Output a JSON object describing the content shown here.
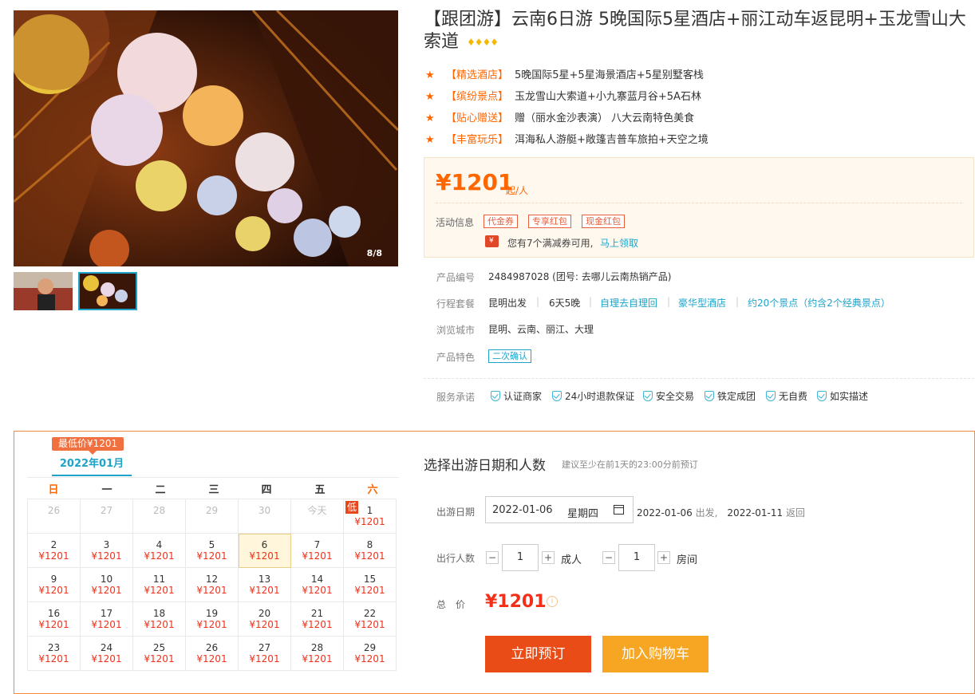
{
  "gallery": {
    "counter": "8/8"
  },
  "product": {
    "title": "【跟团游】云南6日游 5晚国际5星酒店+丽江动车返昆明+玉龙雪山大索道",
    "rating_icon": "diamond-icon"
  },
  "highlights": [
    {
      "tag": "【精选酒店】",
      "text": "5晚国际5星+5星海景酒店+5星别墅客栈"
    },
    {
      "tag": "【缤纷景点】",
      "text": "玉龙雪山大索道+小九寨蓝月谷+5A石林"
    },
    {
      "tag": "【贴心赠送】",
      "text": "赠（丽水金沙表演） 八大云南特色美食"
    },
    {
      "tag": "【丰富玩乐】",
      "text": "洱海私人游艇+敞篷吉普车旅拍+天空之境"
    }
  ],
  "price": {
    "amount": "¥1201",
    "suffix": "起/人",
    "promo_label": "活动信息",
    "promo_tags": [
      "代金券",
      "专享红包",
      "现金红包"
    ],
    "coupon_text": "您有7个满减券可用,",
    "coupon_link": "马上领取"
  },
  "info": {
    "product_no_label": "产品编号",
    "product_no": "2484987028 (团号: 去哪儿云南热销产品)",
    "itinerary_label": "行程套餐",
    "itinerary": [
      "昆明出发",
      "6天5晚"
    ],
    "itinerary_links": [
      "自理去自理回",
      "豪华型酒店",
      "约20个景点（约含2个经典景点）"
    ],
    "cities_label": "浏览城市",
    "cities": "昆明、云南、丽江、大理",
    "feature_label": "产品特色",
    "feature_tag": "二次确认",
    "service_label": "服务承诺",
    "services": [
      "认证商家",
      "24小时退款保证",
      "安全交易",
      "铁定成团",
      "无自费",
      "如实描述"
    ]
  },
  "calendar": {
    "low_price_badge": "最低价¥1201",
    "month": "2022年01月",
    "weekdays": [
      "日",
      "一",
      "二",
      "三",
      "四",
      "五",
      "六"
    ],
    "low_flag": "低",
    "rows": [
      [
        {
          "d": "26",
          "p": ""
        },
        {
          "d": "27",
          "p": ""
        },
        {
          "d": "28",
          "p": ""
        },
        {
          "d": "29",
          "p": ""
        },
        {
          "d": "30",
          "p": ""
        },
        {
          "d": "今天",
          "p": ""
        },
        {
          "d": "1",
          "p": "¥1201"
        }
      ],
      [
        {
          "d": "2",
          "p": "¥1201"
        },
        {
          "d": "3",
          "p": "¥1201"
        },
        {
          "d": "4",
          "p": "¥1201"
        },
        {
          "d": "5",
          "p": "¥1201"
        },
        {
          "d": "6",
          "p": "¥1201"
        },
        {
          "d": "7",
          "p": "¥1201"
        },
        {
          "d": "8",
          "p": "¥1201"
        }
      ],
      [
        {
          "d": "9",
          "p": "¥1201"
        },
        {
          "d": "10",
          "p": "¥1201"
        },
        {
          "d": "11",
          "p": "¥1201"
        },
        {
          "d": "12",
          "p": "¥1201"
        },
        {
          "d": "13",
          "p": "¥1201"
        },
        {
          "d": "14",
          "p": "¥1201"
        },
        {
          "d": "15",
          "p": "¥1201"
        }
      ],
      [
        {
          "d": "16",
          "p": "¥1201"
        },
        {
          "d": "17",
          "p": "¥1201"
        },
        {
          "d": "18",
          "p": "¥1201"
        },
        {
          "d": "19",
          "p": "¥1201"
        },
        {
          "d": "20",
          "p": "¥1201"
        },
        {
          "d": "21",
          "p": "¥1201"
        },
        {
          "d": "22",
          "p": "¥1201"
        }
      ],
      [
        {
          "d": "23",
          "p": "¥1201"
        },
        {
          "d": "24",
          "p": "¥1201"
        },
        {
          "d": "25",
          "p": "¥1201"
        },
        {
          "d": "26",
          "p": "¥1201"
        },
        {
          "d": "27",
          "p": "¥1201"
        },
        {
          "d": "28",
          "p": "¥1201"
        },
        {
          "d": "29",
          "p": "¥1201"
        }
      ]
    ]
  },
  "booking": {
    "title": "选择出游日期和人数",
    "note": "建议至少在前1天的23:00分前预订",
    "date_label": "出游日期",
    "date_value": "2022-01-06",
    "weekday": "星期四",
    "depart_date": "2022-01-06",
    "depart_word": "出发,",
    "return_date": "2022-01-11",
    "return_word": "返回",
    "people_label": "出行人数",
    "adults": "1",
    "adults_unit": "成人",
    "rooms": "1",
    "rooms_unit": "房间",
    "total_label": "总　价",
    "total": "¥1201",
    "book_button": "立即预订",
    "cart_button": "加入购物车",
    "minus": "−",
    "plus": "+"
  }
}
